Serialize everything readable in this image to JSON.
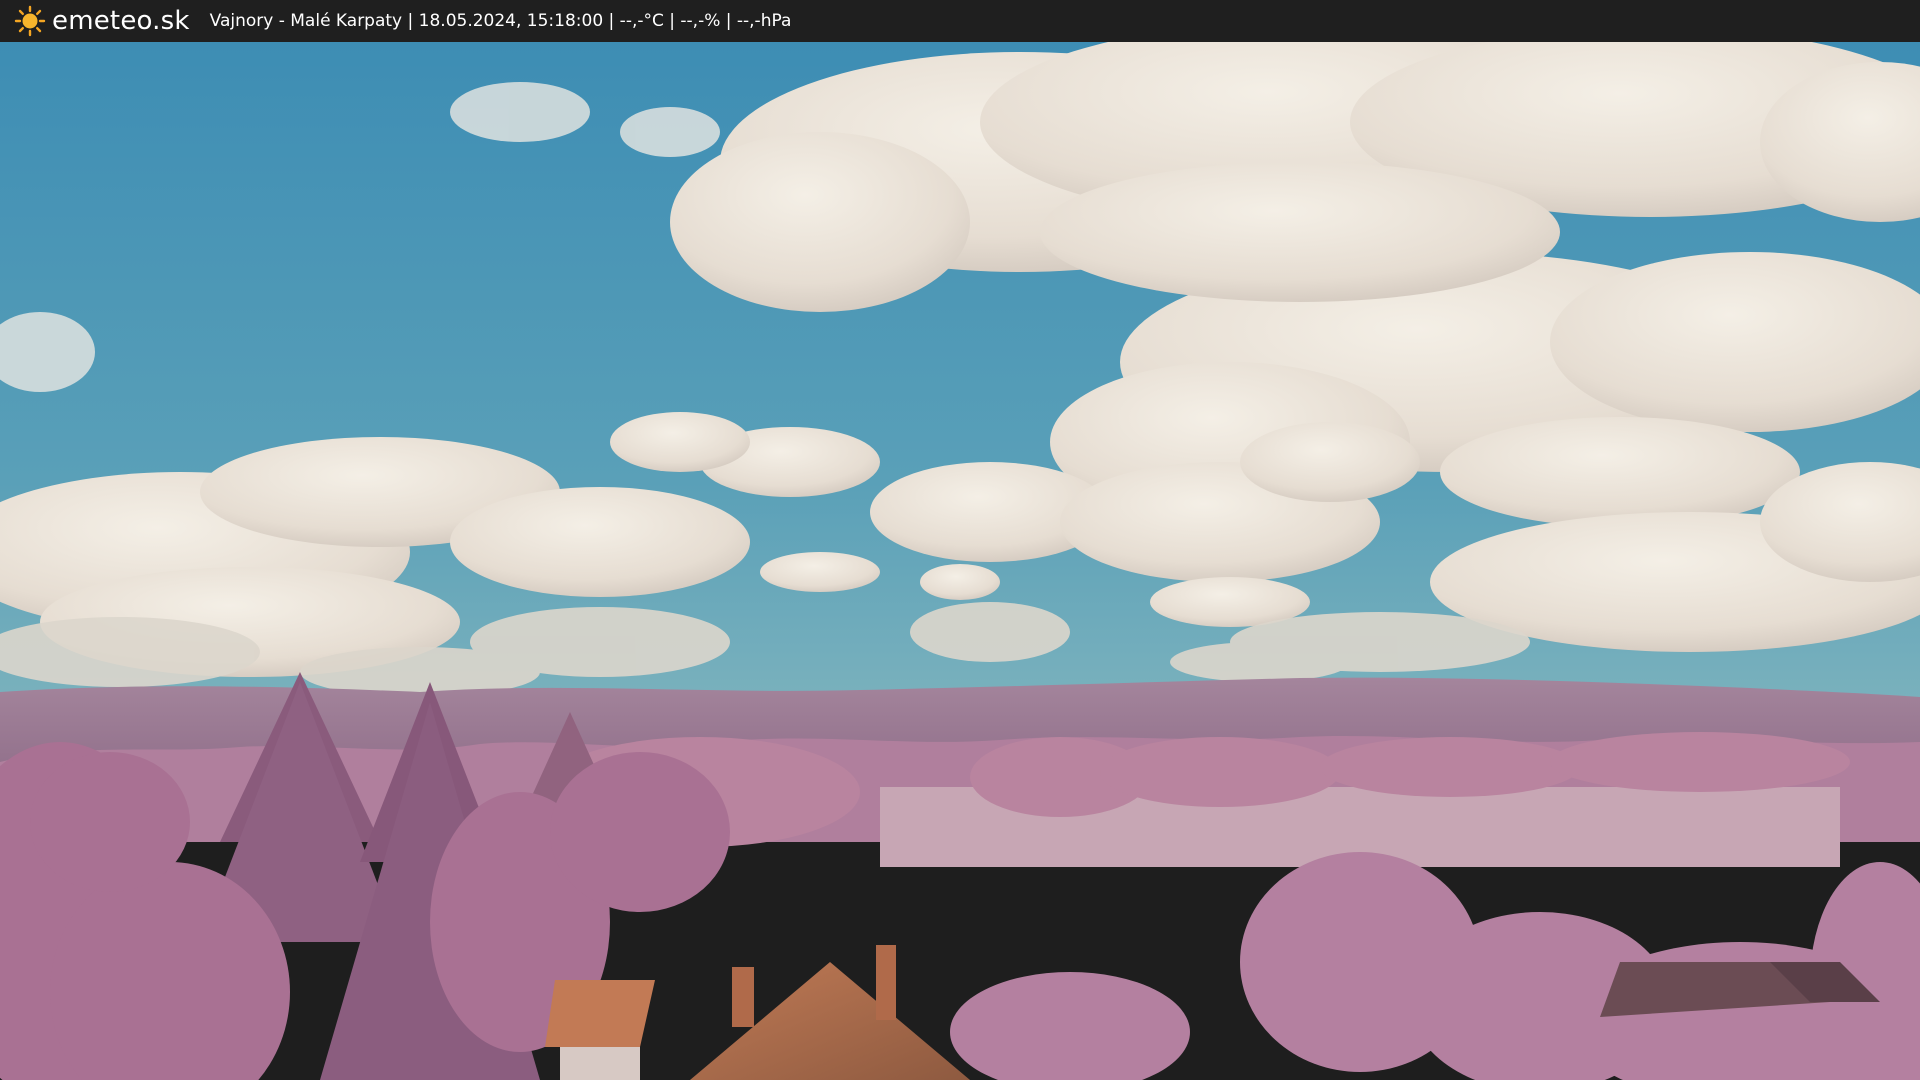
{
  "header": {
    "brand": "emeteo.sk",
    "caption": "Vajnory - Malé Karpaty | 18.05.2024, 15:18:00 | --,-°C | --,-% | --,-hPa",
    "background_color": "#1f1f1f",
    "text_color": "#ffffff"
  },
  "icons": {
    "logo": "sun-icon"
  },
  "colors": {
    "sky_top": "#3f8fb5",
    "sky_bottom": "#7db5bf",
    "clouds": "#e8e0d5",
    "hills": "#9c7894",
    "foliage": "#b7849f",
    "roof": "#b8704f",
    "field": "#c9aab7"
  }
}
